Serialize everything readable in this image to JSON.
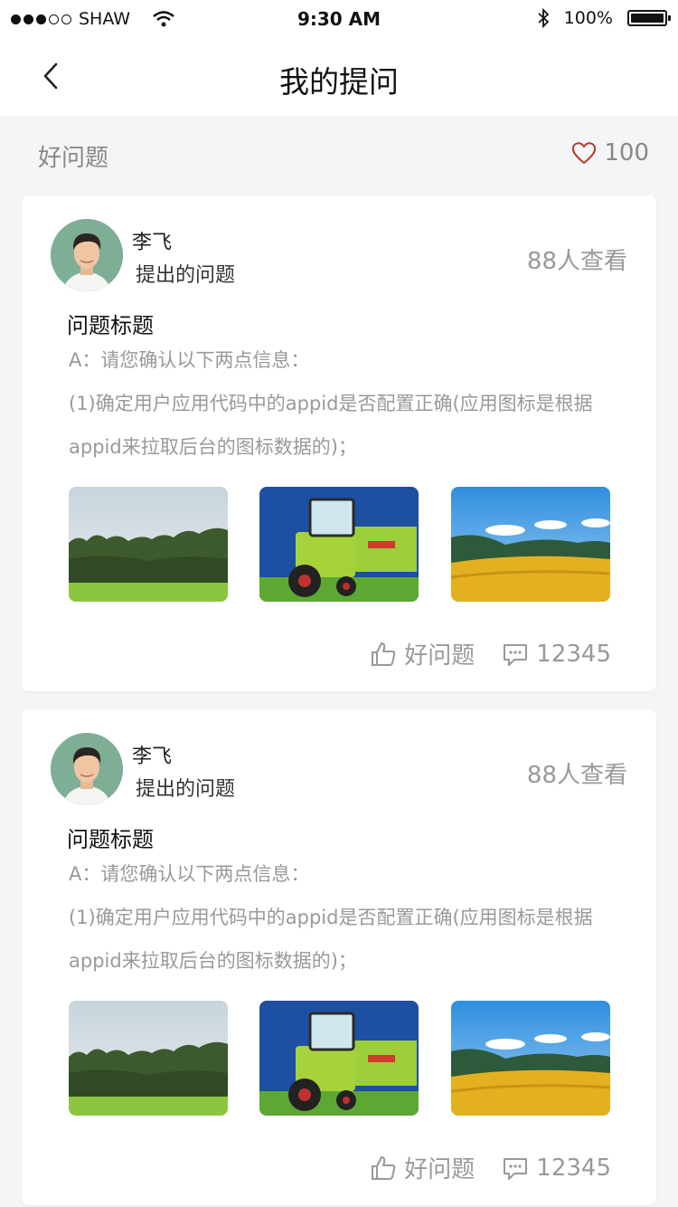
{
  "status_bar": {
    "carrier": "SHAW",
    "time": "9:30 AM",
    "battery_percent": "100%"
  },
  "nav": {
    "title": "我的提问"
  },
  "summary": {
    "label": "好问题",
    "like_count": "100"
  },
  "questions": [
    {
      "author_name": "李飞",
      "author_subtitle": "提出的问题",
      "views": "88人查看",
      "title": "问题标题",
      "answer_intro": "A：请您确认以下两点信息：",
      "answer_body": "(1)确定用户应用代码中的appid是否配置正确(应用图标是根据appid来拉取后台的图标数据的)；",
      "good_question_label": "好问题",
      "comment_count": "12345"
    },
    {
      "author_name": "李飞",
      "author_subtitle": "提出的问题",
      "views": "88人查看",
      "title": "问题标题",
      "answer_intro": "A：请您确认以下两点信息：",
      "answer_body": "(1)确定用户应用代码中的appid是否配置正确(应用图标是根据appid来拉取后台的图标数据的)；",
      "good_question_label": "好问题",
      "comment_count": "12345"
    }
  ],
  "colors": {
    "heart": "#c0392b",
    "muted_text": "#999999",
    "background": "#f4f5f7"
  },
  "icons": {
    "back": "chevron-left-icon",
    "like": "heart-icon",
    "thumb": "thumbs-up-icon",
    "comment": "comment-icon"
  }
}
